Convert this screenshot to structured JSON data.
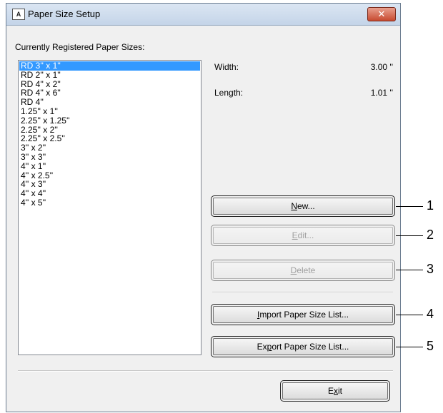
{
  "window": {
    "title": "Paper Size Setup",
    "app_icon": "A",
    "close_glyph": "✕"
  },
  "list": {
    "label": "Currently Registered Paper Sizes:",
    "items": [
      "RD 3'' x 1''",
      "RD 2'' x 1''",
      "RD 4'' x 2''",
      "RD 4'' x 6''",
      "RD 4''",
      "1.25'' x 1''",
      "2.25'' x 1.25''",
      "2.25'' x 2''",
      "2.25'' x 2.5''",
      "3'' x 2''",
      "3'' x 3''",
      "4'' x 1''",
      "4'' x 2.5''",
      "4'' x 3''",
      "4'' x 4''",
      "4'' x 5''"
    ],
    "selected_index": 0
  },
  "info": {
    "width_label": "Width:",
    "width_value": "3.00 ''",
    "length_label": "Length:",
    "length_value": "1.01 ''"
  },
  "buttons": {
    "new": {
      "pre": "",
      "accel": "N",
      "post": "ew..."
    },
    "edit": {
      "pre": "",
      "accel": "E",
      "post": "dit..."
    },
    "delete": {
      "pre": "",
      "accel": "D",
      "post": "elete"
    },
    "import": {
      "pre": "",
      "accel": "I",
      "post": "mport Paper Size List..."
    },
    "export": {
      "pre": "Ex",
      "accel": "p",
      "post": "ort Paper Size List..."
    },
    "exit": {
      "pre": "E",
      "accel": "x",
      "post": "it"
    }
  },
  "callouts": [
    "1",
    "2",
    "3",
    "4",
    "5"
  ]
}
